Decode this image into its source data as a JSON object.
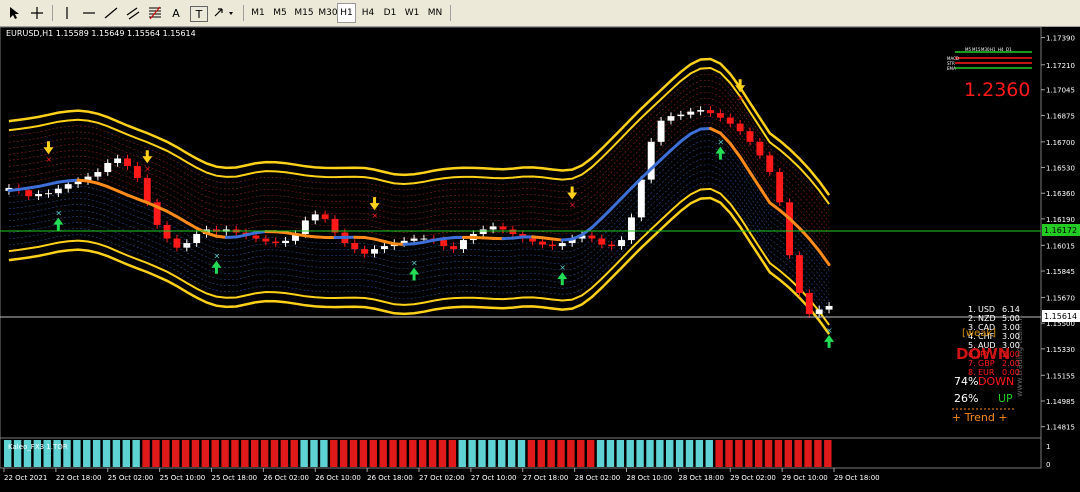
{
  "toolbar": {
    "draw_tools": [
      {
        "icon": "cursor-icon"
      },
      {
        "icon": "crosshair-icon"
      },
      {
        "icon": "vertical-line-icon"
      },
      {
        "icon": "horizontal-line-icon"
      },
      {
        "icon": "trend-line-icon"
      },
      {
        "icon": "channel-icon"
      },
      {
        "icon": "fibonacci-icon"
      },
      {
        "icon": "text-icon",
        "label": "A"
      },
      {
        "icon": "text-label-icon",
        "label": "T"
      },
      {
        "icon": "arrow-shapes-icon"
      }
    ],
    "timeframes": [
      "M1",
      "M5",
      "M15",
      "M30",
      "H1",
      "H4",
      "D1",
      "W1",
      "MN"
    ],
    "active_timeframe": "H1"
  },
  "chart": {
    "title": "EURUSD,H1  1.15589 1.15649 1.15564 1.15614",
    "big_price": "1.2360",
    "current_price_label": "1.15614",
    "line_price_label": "1.16172",
    "watermark": "www.trading-team.it",
    "sub_indicator_label": "Kaleo_FX3 1.TOR",
    "colors": {
      "bull": "#ffffff",
      "bear": "#ff1a1a",
      "band": "#ffd21a",
      "trend_up": "#3d6fd6",
      "trend_down": "#ff8c1a",
      "sub_up": "#5fd3d3",
      "sub_down": "#e01a1a"
    }
  },
  "currency_strength": {
    "rows": [
      {
        "rank": "1.",
        "code": "USD",
        "value": "6.14"
      },
      {
        "rank": "2.",
        "code": "NZD",
        "value": "5.00"
      },
      {
        "rank": "3.",
        "code": "CAD",
        "value": "3.00"
      },
      {
        "rank": "4.",
        "code": "CHF",
        "value": "3.00"
      },
      {
        "rank": "5.",
        "code": "AUD",
        "value": "3.00"
      },
      {
        "rank": "6.",
        "code": "JPY",
        "value": "2.00"
      },
      {
        "rank": "7.",
        "code": "GBP",
        "value": "2.00"
      },
      {
        "rank": "8.",
        "code": "EUR",
        "value": "0.00"
      }
    ],
    "overlay_weak": "[weak]",
    "overlay_down": "DOWN"
  },
  "sentiment": {
    "down_pct": "74%",
    "down_label": "DOWN",
    "up_pct": "26%",
    "up_label": "UP",
    "trend_label": "+   Trend   +"
  },
  "mini_panel": {
    "timeframes": [
      "M5",
      "M15",
      "M30",
      "H1",
      "H4",
      "D1"
    ],
    "labels": [
      "MACD",
      "STR",
      "EMA"
    ]
  },
  "chart_data": {
    "type": "candlestick",
    "symbol": "EURUSD",
    "timeframe": "H1",
    "ohlc_last": {
      "open": 1.15589,
      "high": 1.15649,
      "low": 1.15564,
      "close": 1.15614
    },
    "y_ticks": [
      "1.17390",
      "1.17210",
      "1.17045",
      "1.16875",
      "1.16700",
      "1.16530",
      "1.16360",
      "1.16190",
      "1.16015",
      "1.15845",
      "1.15670",
      "1.15500",
      "1.15330",
      "1.15155",
      "1.14985",
      "1.14815"
    ],
    "ylim": [
      1.1474,
      1.1746
    ],
    "x_ticks": [
      "22 Oct 2021",
      "22 Oct 18:00",
      "25 Oct 02:00",
      "25 Oct 10:00",
      "25 Oct 18:00",
      "26 Oct 02:00",
      "26 Oct 10:00",
      "26 Oct 18:00",
      "27 Oct 02:00",
      "27 Oct 10:00",
      "27 Oct 18:00",
      "28 Oct 02:00",
      "28 Oct 10:00",
      "28 Oct 18:00",
      "29 Oct 02:00",
      "29 Oct 10:00",
      "29 Oct 18:00"
    ],
    "sub_y_ticks": [
      "1",
      "0"
    ],
    "close_series": [
      1.16395,
      1.1638,
      1.1634,
      1.16355,
      1.1636,
      1.1639,
      1.1642,
      1.1644,
      1.1647,
      1.165,
      1.1656,
      1.1659,
      1.1654,
      1.1646,
      1.163,
      1.1615,
      1.1606,
      1.16,
      1.1603,
      1.1609,
      1.1612,
      1.16105,
      1.1612,
      1.161,
      1.1608,
      1.1606,
      1.1604,
      1.1603,
      1.16045,
      1.1609,
      1.1618,
      1.1622,
      1.1619,
      1.161,
      1.1603,
      1.1599,
      1.1596,
      1.1599,
      1.1601,
      1.1603,
      1.16045,
      1.1606,
      1.1606,
      1.1605,
      1.1601,
      1.1599,
      1.1605,
      1.1609,
      1.1612,
      1.1614,
      1.1612,
      1.1609,
      1.1606,
      1.1604,
      1.1602,
      1.1601,
      1.1603,
      1.1606,
      1.1608,
      1.1606,
      1.1602,
      1.1601,
      1.1605,
      1.162,
      1.1645,
      1.167,
      1.1684,
      1.1687,
      1.1688,
      1.169,
      1.1691,
      1.1689,
      1.1686,
      1.1682,
      1.1677,
      1.167,
      1.1661,
      1.165,
      1.163,
      1.1595,
      1.157,
      1.1556,
      1.1559,
      1.15614
    ],
    "sub_signal": [
      1,
      1,
      1,
      1,
      1,
      1,
      1,
      1,
      1,
      1,
      1,
      1,
      1,
      1,
      0,
      0,
      0,
      0,
      0,
      0,
      0,
      0,
      0,
      0,
      0,
      0,
      0,
      0,
      0,
      0,
      1,
      1,
      1,
      0,
      0,
      0,
      0,
      0,
      0,
      0,
      0,
      0,
      0,
      0,
      0,
      0,
      1,
      1,
      1,
      1,
      1,
      1,
      1,
      0,
      0,
      0,
      0,
      0,
      0,
      0,
      1,
      1,
      1,
      1,
      1,
      1,
      1,
      1,
      1,
      1,
      1,
      1,
      0,
      0,
      0,
      0,
      0,
      0,
      0,
      0,
      0,
      0,
      0,
      0
    ],
    "signals": [
      {
        "type": "sell",
        "index": 4
      },
      {
        "type": "buy",
        "index": 5
      },
      {
        "type": "sell",
        "index": 14
      },
      {
        "type": "buy",
        "index": 21
      },
      {
        "type": "sell",
        "index": 37
      },
      {
        "type": "buy",
        "index": 41
      },
      {
        "type": "sell",
        "index": 57
      },
      {
        "type": "buy",
        "index": 56
      },
      {
        "type": "buy",
        "index": 72
      },
      {
        "type": "sell",
        "index": 74
      },
      {
        "type": "buy",
        "index": 96
      }
    ]
  }
}
